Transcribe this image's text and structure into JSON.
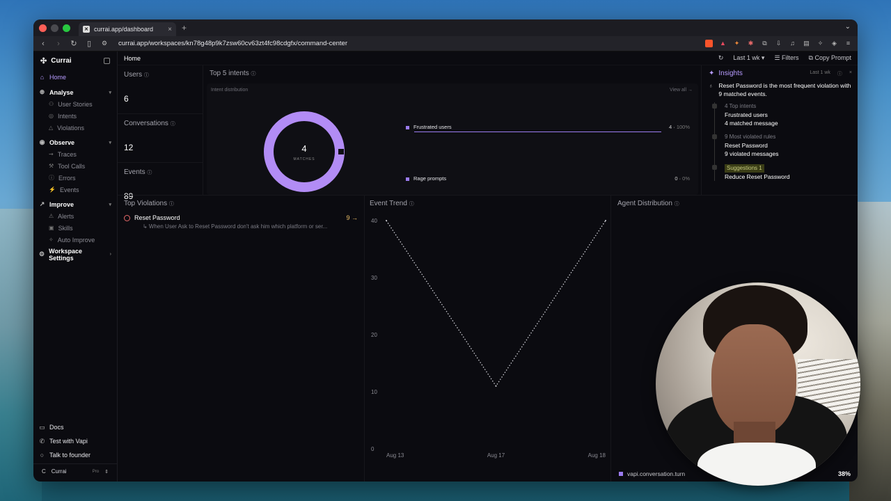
{
  "browser": {
    "tab_title": "currai.app/dashboard",
    "url": "currai.app/workspaces/kn78g48p9k7zsw60cv63zt4fc98cdgfx/command-center"
  },
  "sidebar": {
    "brand": "Currai",
    "home": "Home",
    "analyse": {
      "label": "Analyse",
      "items": [
        "User Stories",
        "Intents",
        "Violations"
      ]
    },
    "observe": {
      "label": "Observe",
      "items": [
        "Traces",
        "Tool Calls",
        "Errors",
        "Events"
      ]
    },
    "improve": {
      "label": "Improve",
      "items": [
        "Alerts",
        "Skills",
        "Auto Improve"
      ]
    },
    "workspace_settings": "Workspace Settings",
    "bottom": [
      "Docs",
      "Test with Vapi",
      "Talk to founder"
    ],
    "user": {
      "name": "Currai",
      "plan": "Pro",
      "initial": "C"
    }
  },
  "topbar": {
    "title": "Home",
    "range": "Last 1 wk",
    "filters": "Filters",
    "copy": "Copy Prompt"
  },
  "stats": [
    {
      "label": "Users",
      "value": "6"
    },
    {
      "label": "Conversations",
      "value": "12"
    },
    {
      "label": "Events",
      "value": "89"
    }
  ],
  "intents": {
    "title": "Top 5 intents",
    "subtitle": "Intent distribution",
    "view_all": "View all →",
    "donut_value": "4",
    "donut_label": "MATCHES",
    "rows": [
      {
        "name": "Frustrated users",
        "count": "4",
        "pct": "100%",
        "fraction": 1.0
      },
      {
        "name": "Rage prompts",
        "count": "0",
        "pct": "0%",
        "fraction": 0.0
      }
    ]
  },
  "insights": {
    "title": "Insights",
    "range": "Last 1 wk",
    "headline": "Reset Password is the most frequent violation with 9 matched events.",
    "items": [
      {
        "tag": "4 Top intents",
        "lines": [
          "Frustrated users",
          "4 matched message"
        ]
      },
      {
        "tag": "9 Most violated rules",
        "lines": [
          "Reset Password",
          "9 violated messages"
        ]
      },
      {
        "tag": "Suggestions 1",
        "lines": [
          "Reduce Reset Password"
        ]
      }
    ]
  },
  "violations": {
    "title": "Top Violations",
    "items": [
      {
        "name": "Reset Password",
        "count": "9 →",
        "desc": "↳ When User Ask to Reset Password don't ask him which platform or ser..."
      }
    ]
  },
  "event_trend": {
    "title": "Event Trend"
  },
  "agent_distribution": {
    "title": "Agent Distribution",
    "legend": "vapi.conversation.turn",
    "percent": "38%"
  },
  "chart_data": {
    "type": "line",
    "x": [
      "Aug 13",
      "Aug 17",
      "Aug 18"
    ],
    "y": [
      40,
      11,
      40
    ],
    "yticks": [
      0,
      10,
      20,
      30,
      40
    ],
    "ylim": [
      0,
      40
    ],
    "color": "#cfcfd6",
    "style": "dotted"
  }
}
